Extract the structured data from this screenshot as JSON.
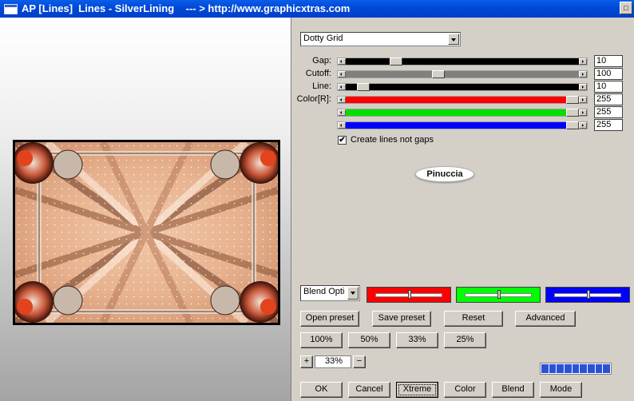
{
  "window": {
    "title": "AP [Lines]  Lines - SilverLining    --- > http://www.graphicxtras.com",
    "close_glyph": "□"
  },
  "effect_select": {
    "value": "Dotty Grid"
  },
  "sliders": [
    {
      "label": "Gap:",
      "value": "10",
      "level": 0.2,
      "color": "#000000"
    },
    {
      "label": "Cutoff:",
      "value": "100",
      "level": 0.39,
      "color": "#808080"
    },
    {
      "label": "Line:",
      "value": "10",
      "level": 0.05,
      "color": "#000000"
    },
    {
      "label": "Color[R]:",
      "value": "255",
      "level": 1.0,
      "color": "#ff0000"
    },
    {
      "label": "",
      "value": "255",
      "level": 1.0,
      "color": "#00e000"
    },
    {
      "label": "",
      "value": "255",
      "level": 1.0,
      "color": "#0000ff"
    }
  ],
  "checkbox": {
    "label": "Create lines not gaps",
    "checked": true,
    "mark": "✔"
  },
  "logo_text": "Pinuccia",
  "blend_select": {
    "value": "Blend Optio"
  },
  "color_swatches": [
    {
      "color": "#ff0000",
      "level": 0.5
    },
    {
      "color": "#00ff00",
      "level": 0.5
    },
    {
      "color": "#0000ff",
      "level": 0.5
    }
  ],
  "buttons": {
    "open_preset": "Open preset",
    "save_preset": "Save preset",
    "reset": "Reset",
    "advanced": "Advanced",
    "zoom_100": "100%",
    "zoom_50": "50%",
    "zoom_33": "33%",
    "zoom_25": "25%",
    "plus": "+",
    "minus": "−",
    "ok": "OK",
    "cancel": "Cancel",
    "xtreme": "Xtreme",
    "color": "Color",
    "blend": "Blend",
    "mode": "Mode"
  },
  "zoom_value": "33%",
  "progress": {
    "segments": 9
  },
  "colors": {
    "titlebar": "#0048d8",
    "progress": "#2a52d8"
  }
}
